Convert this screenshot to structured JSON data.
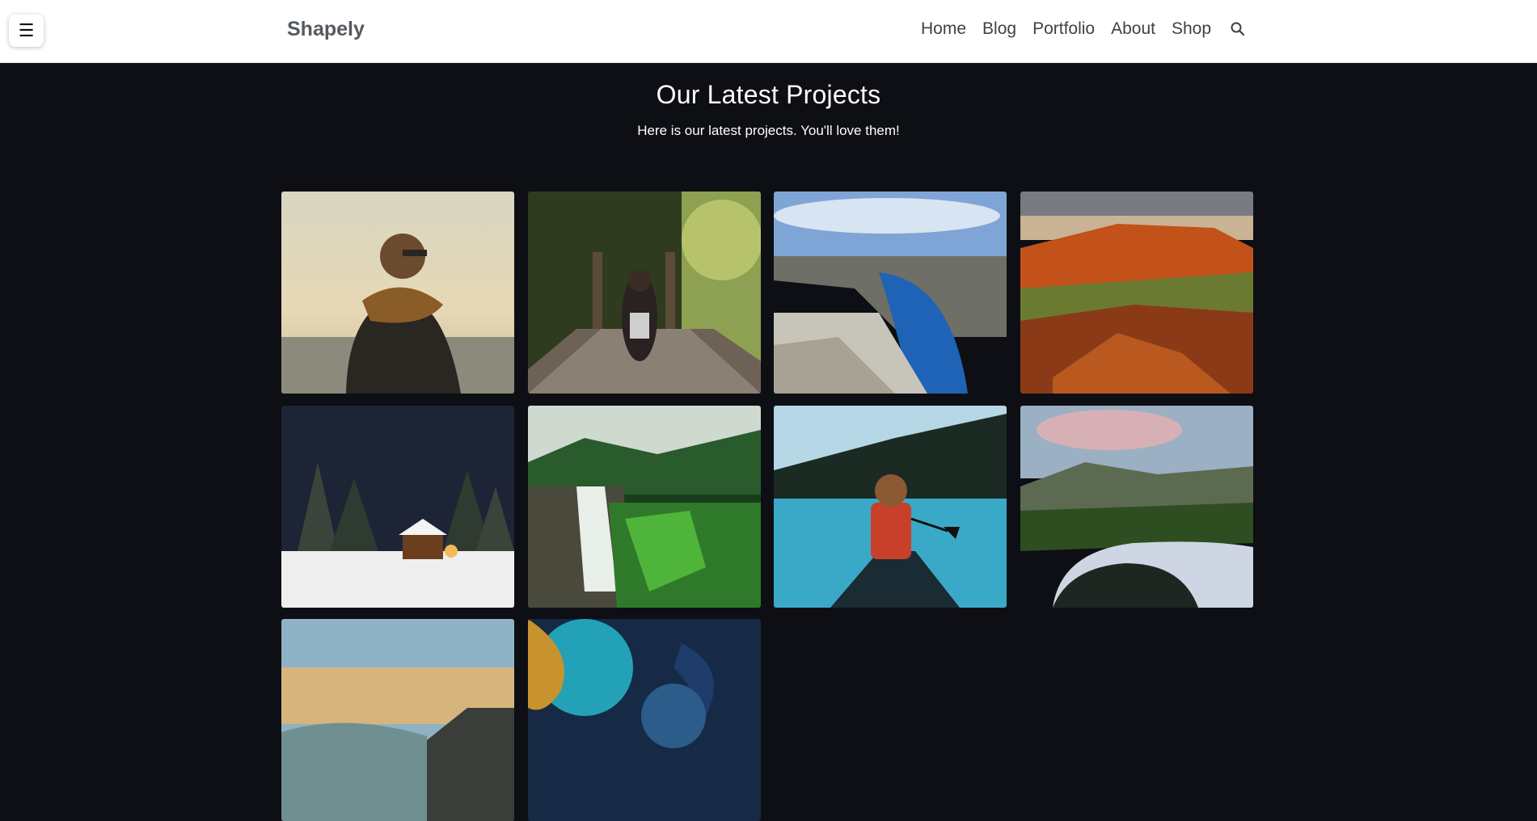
{
  "header": {
    "menu_icon": "☰",
    "logo": "Shapely",
    "nav": [
      "Home",
      "Blog",
      "Portfolio",
      "About",
      "Shop"
    ]
  },
  "hero": {
    "title": "Our Latest Projects",
    "subtitle": "Here is our latest projects. You'll love them!"
  },
  "projects": [
    {
      "name": "man-scarf-beach-photo"
    },
    {
      "name": "woman-forest-bridge-photo"
    },
    {
      "name": "fjord-cliff-photo"
    },
    {
      "name": "red-canyon-sunset-photo"
    },
    {
      "name": "snowy-cabin-night-photo"
    },
    {
      "name": "forest-waterfall-photo"
    },
    {
      "name": "woman-canoe-lake-photo"
    },
    {
      "name": "mountain-lake-reflection-photo"
    },
    {
      "name": "coastal-wave-sunset-photo"
    },
    {
      "name": "abstract-ocean-aerial-photo"
    }
  ],
  "colors": {
    "background": "#0d0f14",
    "header_bg": "#ffffff",
    "logo": "#555a60",
    "nav_text": "#3e4247"
  }
}
